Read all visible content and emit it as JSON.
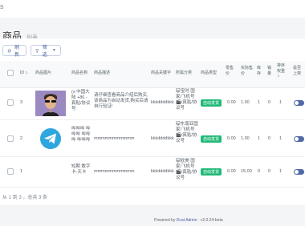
{
  "topbar": {
    "mark": "s"
  },
  "page": {
    "title": "商品",
    "subtitle": "列表"
  },
  "toolbar": {
    "refresh_label": "刷新",
    "filter_label": "筛选"
  },
  "table": {
    "headers": {
      "id": "ID",
      "image": "商品图片",
      "name": "商品名称",
      "desc": "商品描述",
      "keyword": "商品关键字",
      "category": "所属分类",
      "type": "商品类型",
      "price": "零售价",
      "actual_price": "实际售价",
      "stock": "库存",
      "sales": "销量",
      "sort": "排序权重",
      "shelf": "是否上架"
    },
    "sort_arrow": "⇅",
    "rows": [
      {
        "id": "3",
        "name": "(x 中国大陆 +86 - 真贴/协议号",
        "desc": "请仔细查看商品介绍后购买,该商品为自动发货,购买后请自行验证!",
        "keyword": "kkkddddkkk",
        "category_emoji": "😺",
        "category": "宝时 国家/飞机号🎬/真贴/协议号",
        "type": "自动发货",
        "price": "0.00",
        "actual_price": "1.00",
        "stock": "1",
        "sales": "0",
        "sort": "1"
      },
      {
        "id": "2",
        "name": "哔哔哔 哔哔哔 哔哔哔 哔哔哔",
        "desc": "mmmmmmmmmmm",
        "keyword": "kkkddddkkk",
        "category_emoji": "😺",
        "category": "东南亚国家/飞机号🎬/真贴/协议号",
        "type": "自动发货",
        "price": "0.00",
        "actual_price": "1.00",
        "stock": "1",
        "sales": "0",
        "sort": "1"
      },
      {
        "id": "1",
        "name": "短期 数字卡-天卡",
        "desc": "mmmmmmmmmmm",
        "keyword": "kkkddddkkk",
        "category_emoji": "😺",
        "category": "欧美 国家/飞机号🎬/真贴/协议号",
        "type": "自动发货",
        "price": "0.00",
        "actual_price": "15.00",
        "stock": "0",
        "sales": "0",
        "sort": "1"
      }
    ]
  },
  "pagination": {
    "summary": "从 1 到 3 ，总共 3 条"
  },
  "footer": {
    "powered_prefix": "Powered by",
    "brand": "Dcat Admin",
    "version": "· v2.0.24-beta"
  },
  "colors": {
    "accent": "#4f6aa8",
    "badge": "#21b978",
    "toggle": "#4f6aa8"
  }
}
